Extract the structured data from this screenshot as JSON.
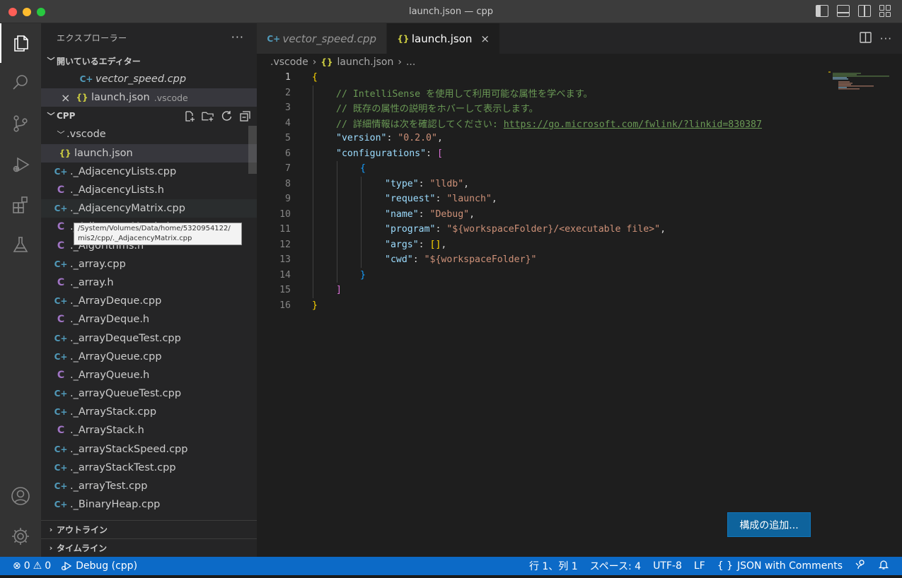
{
  "window": {
    "title": "launch.json — cpp"
  },
  "activity_bar": {
    "items": [
      "explorer-icon",
      "search-icon",
      "source-control-icon",
      "run-debug-icon",
      "extensions-icon",
      "testing-icon"
    ],
    "bottom_items": [
      "account-icon",
      "settings-gear-icon"
    ]
  },
  "sidebar": {
    "header": "エクスプローラー",
    "more": "···",
    "open_editors": {
      "title": "開いているエディター",
      "items": [
        {
          "name": "vector_speed.cpp",
          "icon": "C+"
        },
        {
          "name": "launch.json",
          "icon": "{}",
          "desc": ".vscode",
          "close": "×"
        }
      ]
    },
    "folder": {
      "title": "CPP",
      "subfolder": ".vscode",
      "subfolder_file": "launch.json",
      "files": [
        {
          "name": "._AdjacencyLists.cpp",
          "icon": "C+"
        },
        {
          "name": "._AdjacencyLists.h",
          "icon": "C"
        },
        {
          "name": "._AdjacencyMatrix.cpp",
          "icon": "C+"
        },
        {
          "name": "._AdjacencyMatrix.h",
          "icon": "C"
        },
        {
          "name": "._Algorithms.h",
          "icon": "C"
        },
        {
          "name": "._array.cpp",
          "icon": "C+"
        },
        {
          "name": "._array.h",
          "icon": "C"
        },
        {
          "name": "._ArrayDeque.cpp",
          "icon": "C+"
        },
        {
          "name": "._ArrayDeque.h",
          "icon": "C"
        },
        {
          "name": "._arrayDequeTest.cpp",
          "icon": "C+"
        },
        {
          "name": "._ArrayQueue.cpp",
          "icon": "C+"
        },
        {
          "name": "._ArrayQueue.h",
          "icon": "C"
        },
        {
          "name": "._arrayQueueTest.cpp",
          "icon": "C+"
        },
        {
          "name": "._ArrayStack.cpp",
          "icon": "C+"
        },
        {
          "name": "._ArrayStack.h",
          "icon": "C"
        },
        {
          "name": "._arrayStackSpeed.cpp",
          "icon": "C+"
        },
        {
          "name": "._arrayStackTest.cpp",
          "icon": "C+"
        },
        {
          "name": "._arrayTest.cpp",
          "icon": "C+"
        },
        {
          "name": "._BinaryHeap.cpp",
          "icon": "C+"
        }
      ]
    },
    "tooltip": {
      "line1": "/System/Volumes/Data/home/5320954122/",
      "line2": "mis2/cpp/._AdjacencyMatrix.cpp"
    },
    "outline": "アウトライン",
    "timeline": "タイムライン"
  },
  "editor": {
    "tabs": [
      {
        "label": "vector_speed.cpp",
        "icon": "C+"
      },
      {
        "label": "launch.json",
        "icon": "{}",
        "close": "×"
      }
    ],
    "breadcrumb": {
      "folder": ".vscode",
      "file": "launch.json",
      "more": "..."
    },
    "line_numbers": [
      "1",
      "2",
      "3",
      "4",
      "5",
      "6",
      "7",
      "8",
      "9",
      "10",
      "11",
      "12",
      "13",
      "14",
      "15",
      "16"
    ],
    "code": {
      "comment1": "// IntelliSense を使用して利用可能な属性を学べます。",
      "comment2": "// 既存の属性の説明をホバーして表示します。",
      "comment3_prefix": "// 詳細情報は次を確認してください: ",
      "comment3_link": "https://go.microsoft.com/fwlink/?linkid=830387",
      "version_key": "\"version\"",
      "version_val": "\"0.2.0\"",
      "configurations_key": "\"configurations\"",
      "type_key": "\"type\"",
      "type_val": "\"lldb\"",
      "request_key": "\"request\"",
      "request_val": "\"launch\"",
      "name_key": "\"name\"",
      "name_val": "\"Debug\"",
      "program_key": "\"program\"",
      "program_val": "\"${workspaceFolder}/<executable file>\"",
      "args_key": "\"args\"",
      "args_val": "[]",
      "cwd_key": "\"cwd\"",
      "cwd_val": "\"${workspaceFolder}\""
    },
    "add_config_button": "構成の追加..."
  },
  "status_bar": {
    "errors": "0",
    "warnings": "0",
    "debug": "Debug (cpp)",
    "position": "行 1、列 1",
    "spaces": "スペース: 4",
    "encoding": "UTF-8",
    "eol": "LF",
    "language": "JSON with Comments"
  },
  "colors": {
    "status_bar": "#0c6ac7",
    "accent_button": "#0e639c",
    "cpp_icon": "#519aba",
    "header_icon": "#a074c4",
    "json_icon": "#cbcb41"
  }
}
